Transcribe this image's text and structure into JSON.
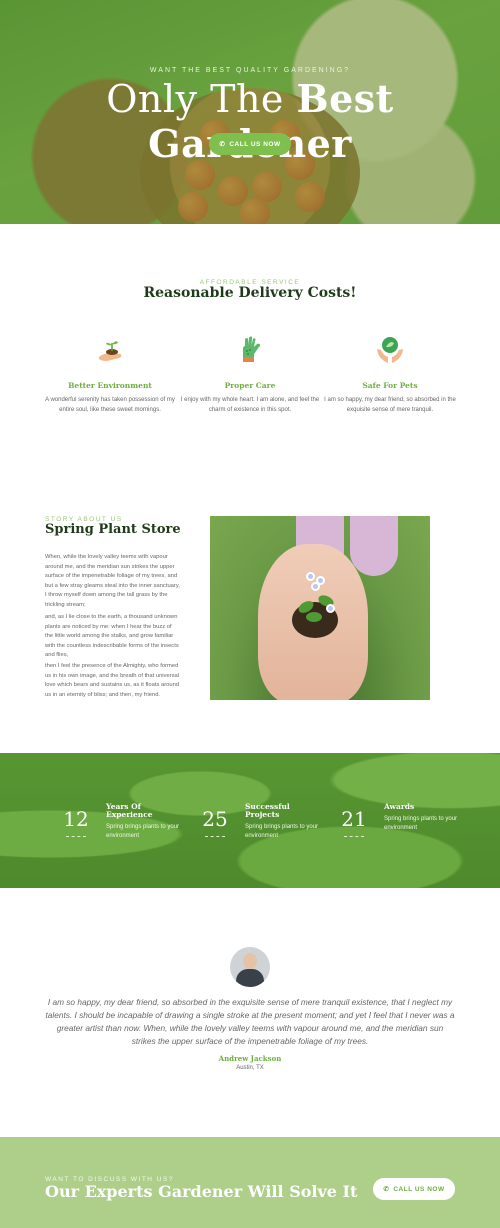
{
  "hero": {
    "eyebrow": "WANT THE BEST QUALITY GARDENING?",
    "title_light": "Only The ",
    "title_bold": "Best Gardener",
    "cta_label": "CALL US NOW",
    "cta_icon": "phone-icon"
  },
  "services": {
    "eyebrow": "AFFORDABLE SERVICE",
    "title": "Reasonable Delivery Costs!",
    "items": [
      {
        "icon": "sprout-hand-icon",
        "title": "Better Environment",
        "text": "A wonderful serenity has taken possession of my entire soul, like these sweet mornings."
      },
      {
        "icon": "garden-glove-icon",
        "title": "Proper Care",
        "text": "I enjoy with my whole heart. I am alone, and feel the charm of existence in this spot."
      },
      {
        "icon": "hands-leaf-icon",
        "title": "Safe For Pets",
        "text": "I am so happy, my dear friend, so absorbed in the exquisite sense of mere tranquil."
      }
    ]
  },
  "about": {
    "eyebrow": "STORY ABOUT US",
    "title": "Spring Plant Store",
    "paragraphs": [
      "When, while the lovely valley teems with vapour around me, and the meridian sun strikes the upper surface of the impenetrable foliage of my trees, and but a few stray gleams steal into the inner sanctuary, I throw myself down among the tall grass by the trickling stream;",
      "and, as I lie close to the earth, a thousand unknown plants are noticed by me: when I hear the buzz of the little world among the stalks, and grow familiar with the countless indescribable forms of the insects and flies,",
      "then I feel the presence of the Almighty, who formed us in his own image, and the breath of that universal love which bears and sustains us, as it floats around us in an eternity of bliss; and then, my friend."
    ]
  },
  "stats": [
    {
      "number": "12",
      "label": "Years Of Experience",
      "text": "Spring brings plants to your environment"
    },
    {
      "number": "25",
      "label": "Successful Projects",
      "text": "Spring brings plants to your environment"
    },
    {
      "number": "21",
      "label": "Awards",
      "text": "Spring brings plants to your environment"
    }
  ],
  "testimonial": {
    "quote": "I am so happy, my dear friend, so absorbed in the exquisite sense of mere tranquil existence, that I neglect my talents. I should be incapable of drawing a single stroke at the present moment; and yet I feel that I never was a greater artist than now. When, while the lovely valley teems with vapour around me, and the meridian sun strikes the upper surface of the impenetrable foliage of my trees.",
    "author": "Andrew Jackson",
    "location": "Austin, TX"
  },
  "cta": {
    "eyebrow": "WANT TO DISCUSS WITH US?",
    "title": "Our Experts Gardener Will Solve It",
    "button_label": "CALL US NOW",
    "button_icon": "phone-icon"
  },
  "colors": {
    "accent_green": "#7fbf4d",
    "dark_heading": "#1f3b1a",
    "cta_band": "#aecf8a"
  }
}
